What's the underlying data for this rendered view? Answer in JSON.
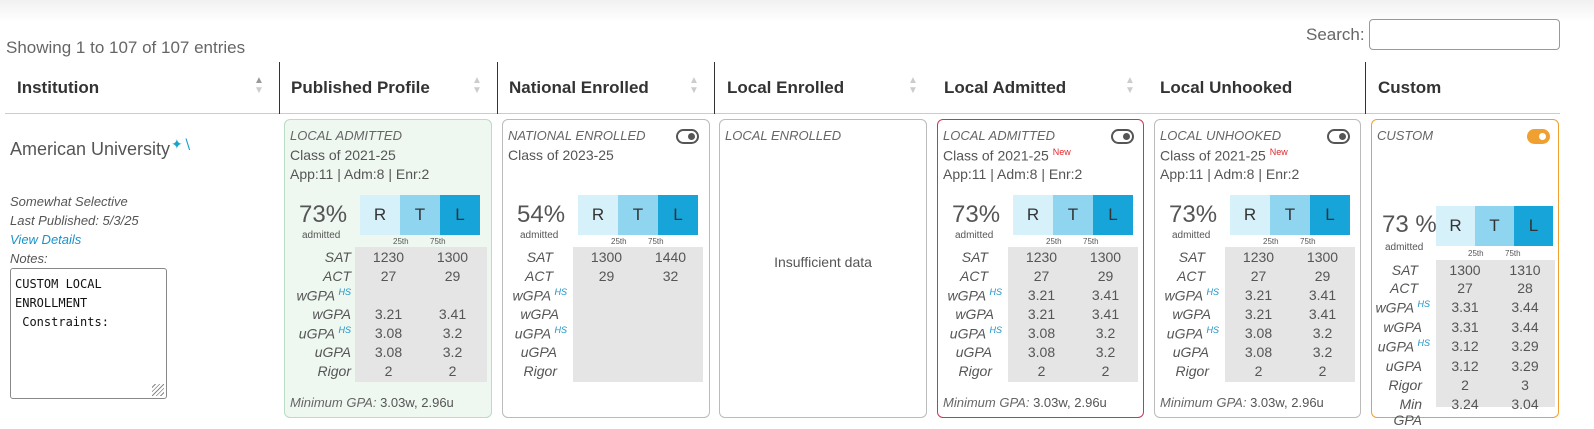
{
  "table_info": {
    "showing": "Showing 1 to 107 of 107 entries",
    "search_label": "Search:",
    "search_value": ""
  },
  "columns": {
    "institution": "Institution",
    "published": "Published Profile",
    "national": "National Enrolled",
    "local_enrolled": "Local Enrolled",
    "local_admitted": "Local Admitted",
    "local_unhooked": "Local Unhooked",
    "custom": "Custom"
  },
  "institution": {
    "name": "American University",
    "icon": "magic-wand-icon",
    "selectivity": "Somewhat Selective",
    "last_published": "Last Published: 5/3/25",
    "view_details": "View Details",
    "notes_label": "Notes:",
    "notes_value": "CUSTOM LOCAL\nENROLLMENT\n Constraints:"
  },
  "labels": {
    "admitted": "admitted",
    "p25": "25th",
    "p75": "75th",
    "r": "R",
    "t": "T",
    "l": "L",
    "sat": "SAT",
    "act": "ACT",
    "wgpa": "wGPA",
    "ugpa": "uGPA",
    "rigor": "Rigor",
    "hs": "HS",
    "min_gpa_label": "Minimum GPA:",
    "min_gpa_short": "Min GPA",
    "new": "New",
    "insufficient": "Insufficient data"
  },
  "cards": {
    "published": {
      "title": "LOCAL ADMITTED",
      "class": "Class of 2021-25",
      "app": "App:11 | Adm:8 | Enr:2",
      "pct": "73%",
      "sat": [
        "1230",
        "1300"
      ],
      "act": [
        "27",
        "29"
      ],
      "wgpa_hs": [
        "",
        ""
      ],
      "wgpa": [
        "3.21",
        "3.41"
      ],
      "ugpa_hs": [
        "3.08",
        "3.2"
      ],
      "ugpa": [
        "3.08",
        "3.2"
      ],
      "rigor": [
        "2",
        "2"
      ],
      "min_gpa": "3.03w, 2.96u"
    },
    "national": {
      "title": "NATIONAL ENROLLED",
      "class": "Class of 2023-25",
      "toggle_on": false,
      "pct": "54%",
      "sat": [
        "1300",
        "1440"
      ],
      "act": [
        "29",
        "32"
      ]
    },
    "local_enrolled": {
      "title": "LOCAL ENROLLED"
    },
    "local_admitted": {
      "title": "LOCAL ADMITTED",
      "class": "Class of 2021-25",
      "app": "App:11 | Adm:8 | Enr:2",
      "toggle_on": false,
      "pct": "73%",
      "sat": [
        "1230",
        "1300"
      ],
      "act": [
        "27",
        "29"
      ],
      "wgpa_hs": [
        "3.21",
        "3.41"
      ],
      "wgpa": [
        "3.21",
        "3.41"
      ],
      "ugpa_hs": [
        "3.08",
        "3.2"
      ],
      "ugpa": [
        "3.08",
        "3.2"
      ],
      "rigor": [
        "2",
        "2"
      ],
      "min_gpa": "3.03w, 2.96u"
    },
    "local_unhooked": {
      "title": "LOCAL UNHOOKED",
      "class": "Class of 2021-25",
      "app": "App:11 | Adm:8 | Enr:2",
      "toggle_on": false,
      "pct": "73%",
      "sat": [
        "1230",
        "1300"
      ],
      "act": [
        "27",
        "29"
      ],
      "wgpa_hs": [
        "3.21",
        "3.41"
      ],
      "wgpa": [
        "3.21",
        "3.41"
      ],
      "ugpa_hs": [
        "3.08",
        "3.2"
      ],
      "ugpa": [
        "3.08",
        "3.2"
      ],
      "rigor": [
        "2",
        "2"
      ],
      "min_gpa": "3.03w, 2.96u"
    },
    "custom": {
      "title": "CUSTOM",
      "toggle_on": true,
      "pct": "73 %",
      "sat": [
        "1300",
        "1310"
      ],
      "act": [
        "27",
        "28"
      ],
      "wgpa_hs": [
        "3.31",
        "3.44"
      ],
      "wgpa": [
        "3.31",
        "3.44"
      ],
      "ugpa_hs": [
        "3.12",
        "3.29"
      ],
      "ugpa": [
        "3.12",
        "3.29"
      ],
      "rigor": [
        "2",
        "3"
      ],
      "min_gpa": [
        "3.24",
        "3.04"
      ]
    }
  },
  "colors": {
    "r": "#d7f1fb",
    "t": "#8fd5f0",
    "l": "#17a4d8",
    "accent": "#1a93c8",
    "new": "#e0282e",
    "red_border": "#c23b55",
    "orange": "#f0a030",
    "green_bg": "#eef7f0"
  }
}
